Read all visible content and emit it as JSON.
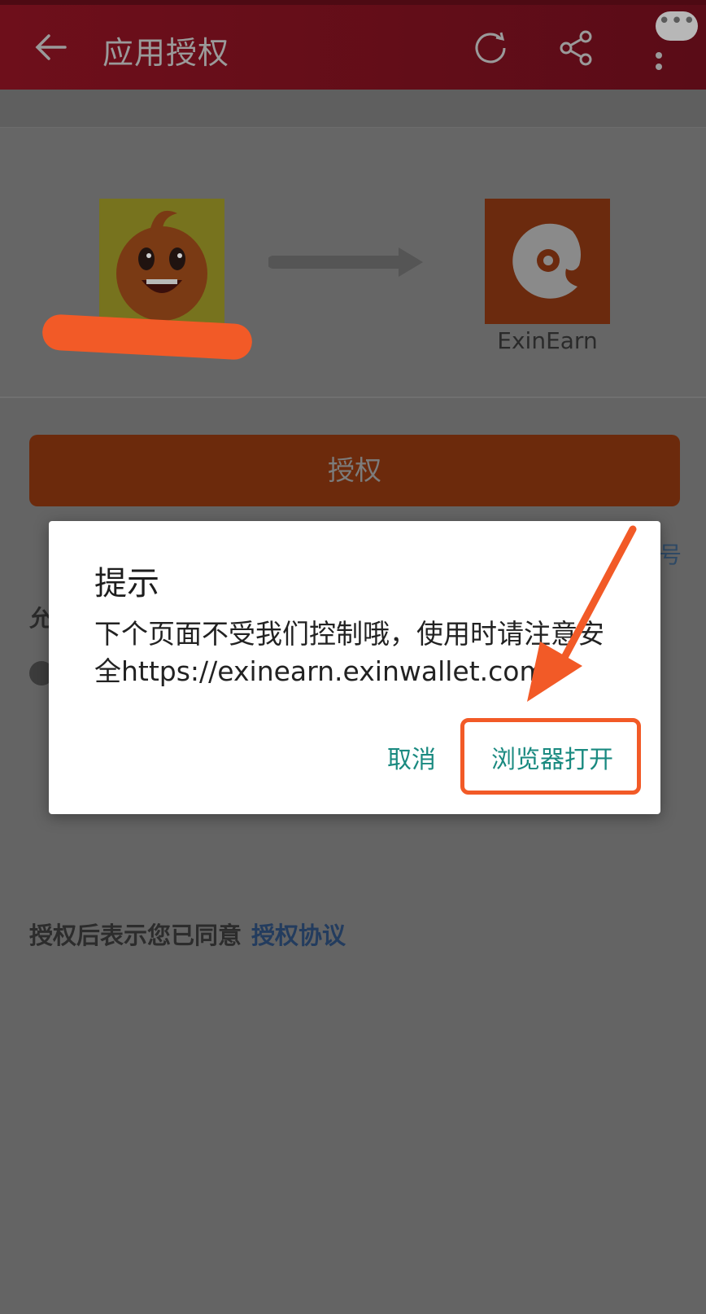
{
  "header": {
    "title": "应用授权",
    "chat_bubble": "•••",
    "icons": [
      "back-arrow-icon",
      "refresh-icon",
      "share-icon",
      "more-vertical-icon"
    ]
  },
  "auth": {
    "app_name": "ExinEarn",
    "authorize_label": "授权",
    "agreement_text": "授权后表示您已同意",
    "agreement_link": "授权协议",
    "partially_hidden_left": "允",
    "partially_hidden_right": "号"
  },
  "dialog": {
    "title": "提示",
    "message": "下个页面不受我们控制哦，使用时请注意安全https://exinearn.exinwallet.com",
    "cancel_label": "取消",
    "open_label": "浏览器打开"
  },
  "colors": {
    "appbar": "#6e0f1b",
    "overlay_background": "#646464",
    "authorize_button": "#6c2a0c",
    "dialog_action": "#1a8a80",
    "annotation": "#f25a27",
    "link": "#233c5e"
  }
}
